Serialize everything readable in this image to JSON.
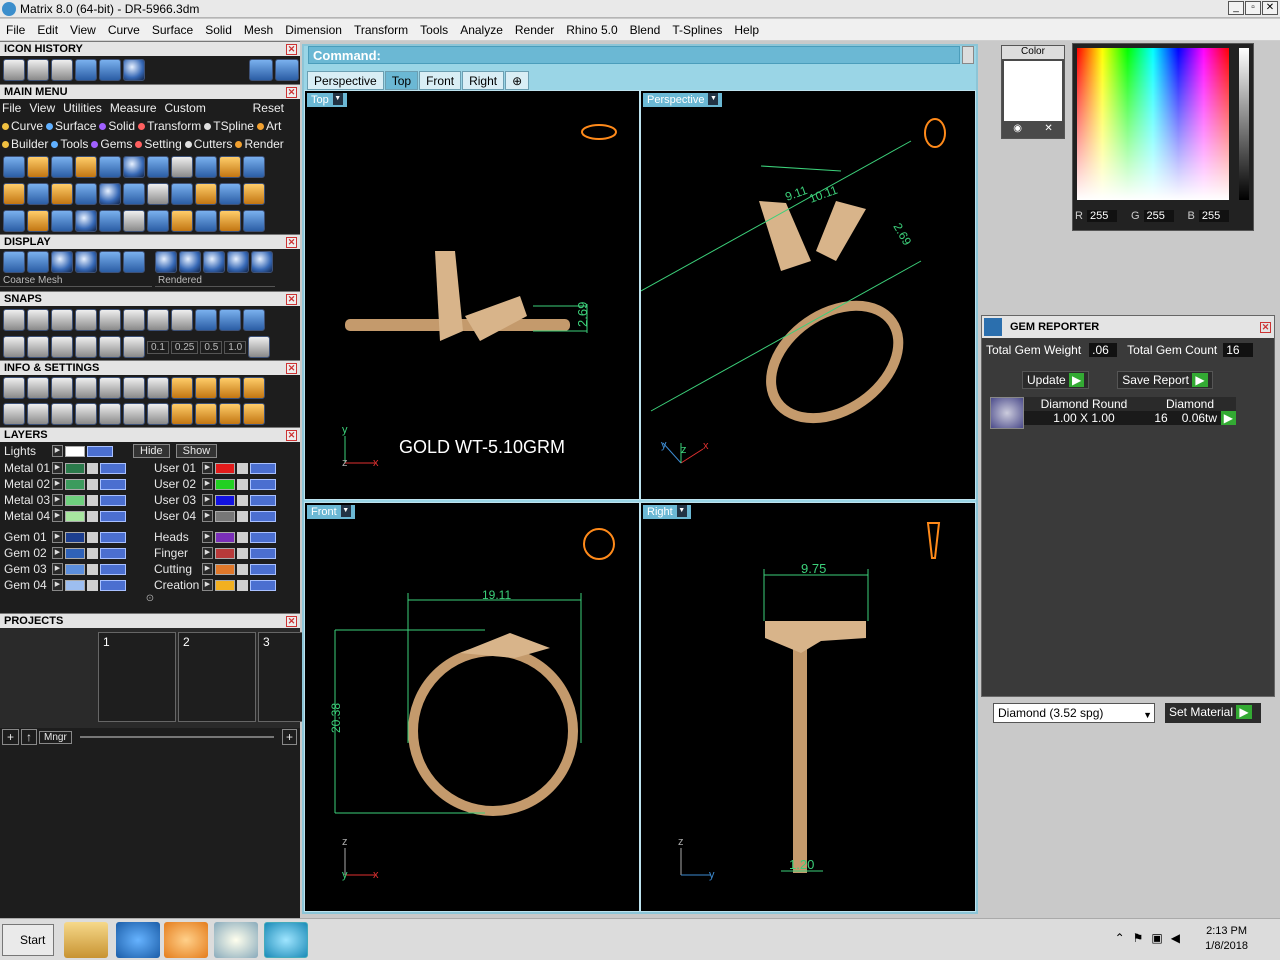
{
  "window": {
    "title": "Matrix 8.0 (64-bit) - DR-5966.3dm"
  },
  "menubar": [
    "File",
    "Edit",
    "View",
    "Curve",
    "Surface",
    "Solid",
    "Mesh",
    "Dimension",
    "Transform",
    "Tools",
    "Analyze",
    "Render",
    "Rhino 5.0",
    "Blend",
    "T-Splines",
    "Help"
  ],
  "panels": {
    "icon_history": "ICON HISTORY",
    "main_menu": "MAIN MENU",
    "display": "DISPLAY",
    "snaps": "SNAPS",
    "info": "INFO & SETTINGS",
    "layers": "LAYERS",
    "projects": "PROJECTS"
  },
  "mainmenu": {
    "row1": [
      "File",
      "View",
      "Utilities",
      "Measure",
      "Custom"
    ],
    "reset": "Reset",
    "row2": [
      "Curve",
      "Surface",
      "Solid",
      "Transform",
      "TSpline",
      "Art"
    ],
    "row3": [
      "Builder",
      "Tools",
      "Gems",
      "Setting",
      "Cutters",
      "Render"
    ]
  },
  "display": {
    "mesh": "Coarse Mesh",
    "mode": "Rendered"
  },
  "snaps": {
    "values": [
      "0.1",
      "0.25",
      "0.5",
      "1.0"
    ]
  },
  "layers": {
    "lights": "Lights",
    "hide": "Hide",
    "show": "Show",
    "left": [
      {
        "n": "Metal 01",
        "c": "#2b7a4b"
      },
      {
        "n": "Metal 02",
        "c": "#3c9b5d"
      },
      {
        "n": "Metal 03",
        "c": "#6fd07e"
      },
      {
        "n": "Metal 04",
        "c": "#a8e6a0"
      },
      {
        "n": "Gem 01",
        "c": "#1d3f8f"
      },
      {
        "n": "Gem 02",
        "c": "#2f62b8"
      },
      {
        "n": "Gem 03",
        "c": "#5c8fdd"
      },
      {
        "n": "Gem 04",
        "c": "#9dbef0"
      }
    ],
    "right": [
      {
        "n": "User 01",
        "c": "#e21b1b"
      },
      {
        "n": "User 02",
        "c": "#22d022"
      },
      {
        "n": "User 03",
        "c": "#1212e0"
      },
      {
        "n": "User 04",
        "c": "#777777"
      },
      {
        "n": "Heads",
        "c": "#7a2fb8"
      },
      {
        "n": "Finger",
        "c": "#b83a3a"
      },
      {
        "n": "Cutting",
        "c": "#e0782a"
      },
      {
        "n": "Creation",
        "c": "#f2b020"
      }
    ]
  },
  "projects": {
    "slots": [
      "1",
      "2",
      "3"
    ],
    "mngr": "Mngr"
  },
  "command": {
    "label": "Command:"
  },
  "tabs": [
    "Perspective",
    "Top",
    "Front",
    "Right"
  ],
  "viewports": {
    "top": "Top",
    "perspective": "Perspective",
    "front": "Front",
    "right": "Right"
  },
  "annotations": {
    "gold": "GOLD WT-5.10GRM",
    "top_dim": "2.69",
    "persp_dim1": "9.11",
    "persp_dim2": "10.11",
    "persp_dim3": "2.69",
    "front_w": "19.11",
    "front_h": "20.38",
    "right_w": "9.75",
    "right_b": "1.20"
  },
  "axes": {
    "x": "x",
    "y": "y",
    "z": "z"
  },
  "color": {
    "title": "Color",
    "r_label": "R",
    "g_label": "G",
    "b_label": "B",
    "r": "255",
    "g": "255",
    "b": "255"
  },
  "gem_reporter": {
    "title": "GEM REPORTER",
    "weight_label": "Total Gem Weight",
    "weight": ".06",
    "count_label": "Total Gem Count",
    "count": "16",
    "update": "Update",
    "save": "Save Report",
    "shape": "Diamond Round",
    "size": "1.00 X 1.00",
    "type": "Diamond",
    "qty": "16",
    "tw": "0.06tw",
    "material": "Diamond    (3.52 spg)",
    "set_material": "Set Material"
  },
  "taskbar": {
    "start": "Start",
    "time": "2:13 PM",
    "date": "1/8/2018"
  }
}
